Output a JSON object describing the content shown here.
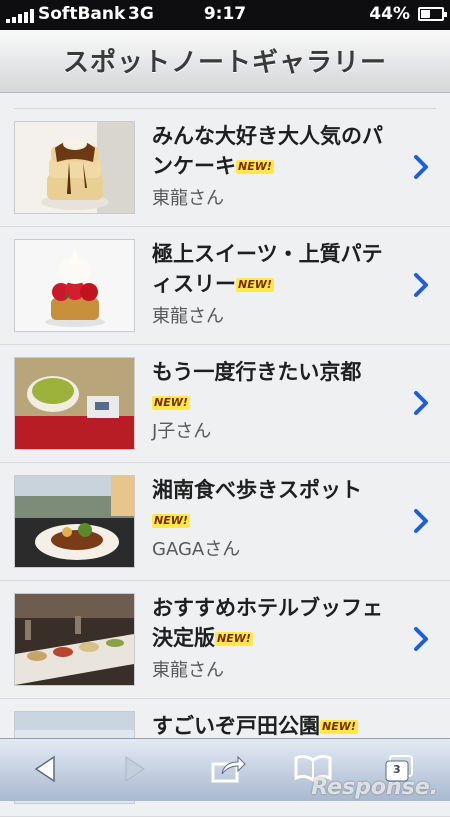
{
  "status_bar": {
    "carrier": "SoftBank",
    "network": "3G",
    "time": "9:17",
    "battery_percent": "44%",
    "battery_level": 0.44
  },
  "header": {
    "title": "スポットノートギャラリー"
  },
  "new_badge": "NEW!",
  "items": [
    {
      "title": "みんな大好き大人気のパンケーキ",
      "author": "東龍さん",
      "thumb": "pancake-photo"
    },
    {
      "title": "極上スイーツ・上質パティスリー",
      "author": "東龍さん",
      "thumb": "cake-photo"
    },
    {
      "title": "もう一度行きたい京都",
      "author": "J子さん",
      "thumb": "matcha-photo"
    },
    {
      "title": "湘南食べ歩きスポット",
      "author": "GAGAさん",
      "thumb": "seaside-dish-photo"
    },
    {
      "title": "おすすめホテルブッフェ決定版",
      "author": "東龍さん",
      "thumb": "buffet-photo"
    },
    {
      "title": "すごいぞ戸田公園",
      "author": "",
      "thumb": "park-photo"
    }
  ],
  "toolbar": {
    "tabs_count": "3",
    "watermark": "Response."
  },
  "colors": {
    "accent_chevron": "#1f5fd6",
    "badge_bg": "#ffe94a",
    "toolbar_top": "#e3eaf4",
    "toolbar_bottom": "#a9b9cf"
  }
}
